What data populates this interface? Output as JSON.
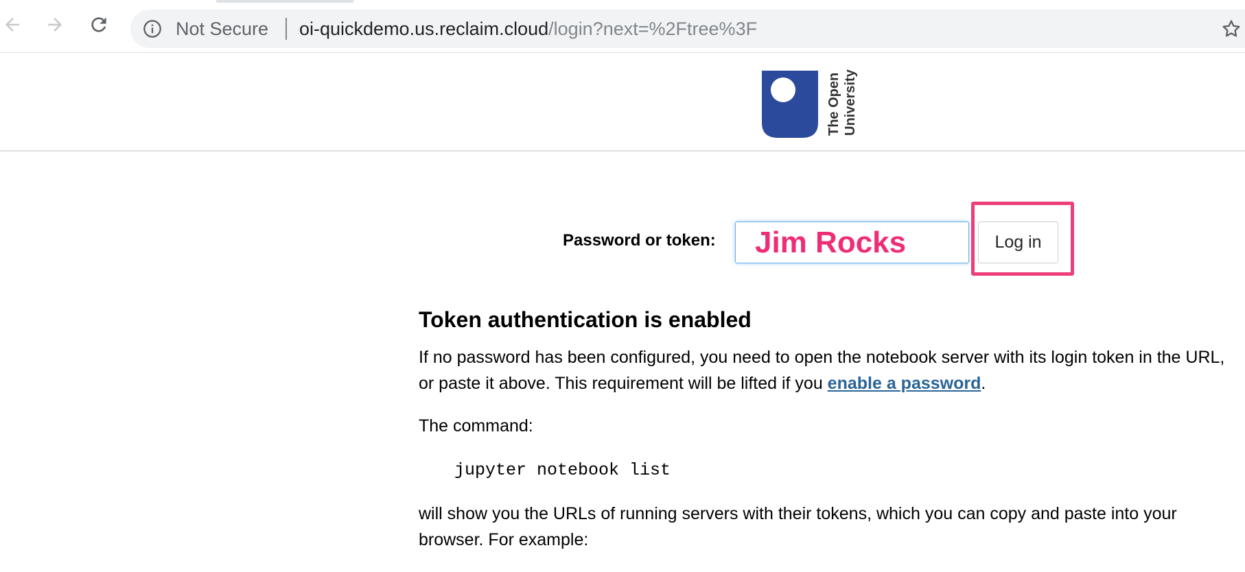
{
  "browser": {
    "back_icon": "arrow-left-icon",
    "forward_icon": "arrow-right-icon",
    "reload_icon": "reload-icon",
    "security_icon": "info-circle-icon",
    "security_label": "Not Secure",
    "url_host": "oi-quickdemo.us.reclaim.cloud",
    "url_path": "/login?next=%2Ftree%3F",
    "bookmark_icon": "star-icon"
  },
  "header": {
    "logo_text_line1": "The Open",
    "logo_text_line2": "University",
    "logo_color": "#2b4a9b"
  },
  "login": {
    "label": "Password or token:",
    "input_value": "Jim Rocks",
    "button_label": "Log in",
    "highlight_color": "#ec3f7a"
  },
  "content": {
    "heading": "Token authentication is enabled",
    "para1_text": "If no password has been configured, you need to open the notebook server with its login token in the URL, or paste it above. This requirement will be lifted if you ",
    "para1_link": "enable a password",
    "para1_end": ".",
    "para2": "The command:",
    "command": "jupyter notebook list",
    "para3": "will show you the URLs of running servers with their tokens, which you can copy and paste into your browser. For example:"
  }
}
